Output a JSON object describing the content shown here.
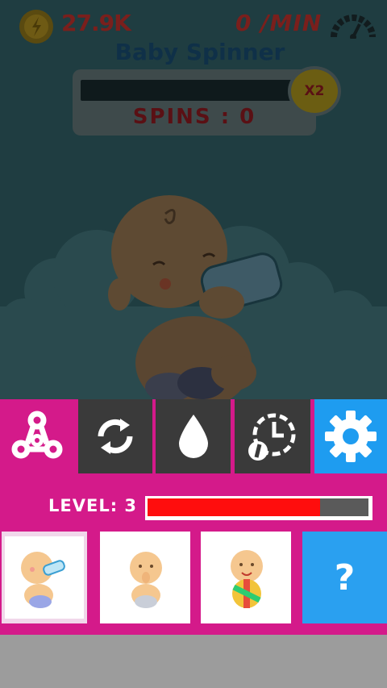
{
  "hud": {
    "coins": "27.9K",
    "coin_icon": "coin-icon",
    "rate": "0 /MIN",
    "speed_icon": "speedometer-icon"
  },
  "game": {
    "title": "Baby Spinner",
    "multiplier": "X2",
    "spins_label": "SPINS : 0",
    "progress": 0
  },
  "toolbar": {
    "items": [
      {
        "icon": "spinner-icon",
        "selected": true
      },
      {
        "icon": "refresh-icon"
      },
      {
        "icon": "drop-icon"
      },
      {
        "icon": "timer-boost-icon"
      },
      {
        "icon": "gear-icon"
      }
    ]
  },
  "level": {
    "label": "LEVEL:",
    "value": "3",
    "progress": 0.78
  },
  "skins": {
    "items": [
      {
        "icon": "baby-bottle-icon",
        "selected": true
      },
      {
        "icon": "baby-thumb-icon"
      },
      {
        "icon": "baby-ball-icon"
      }
    ],
    "locked_label": "?"
  },
  "colors": {
    "primary_magenta": "#d41a8a",
    "toolbar_dark": "#3a3a3a",
    "settings_blue": "#1e9cf0",
    "locked_blue": "#2aa0f0",
    "level_fill": "#ff0d0d",
    "overlay_teal": "#1f3d41"
  }
}
